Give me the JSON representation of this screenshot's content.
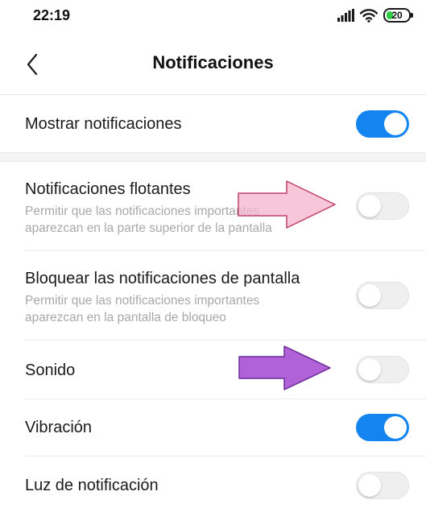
{
  "status_bar": {
    "time": "22:19",
    "battery_level": "20",
    "icons": [
      "signal-icon",
      "wifi-icon",
      "battery-icon"
    ]
  },
  "header": {
    "title": "Notificaciones",
    "back_icon": "chevron-left-icon"
  },
  "settings": [
    {
      "title": "Mostrar notificaciones",
      "subtitle": "",
      "enabled": true
    },
    {
      "title": "Notificaciones flotantes",
      "subtitle_line1": "Permitir que las notificaciones importantes",
      "subtitle_line2": "aparezcan en la parte superior de la pantalla",
      "enabled": false
    },
    {
      "title": "Bloquear las notificaciones de pantalla",
      "subtitle_line1": "Permitir que las notificaciones importantes",
      "subtitle_line2": "aparezcan en la pantalla de bloqueo",
      "enabled": false
    },
    {
      "title": "Sonido",
      "subtitle": "",
      "enabled": false
    },
    {
      "title": "Vibración",
      "subtitle": "",
      "enabled": true
    },
    {
      "title": "Luz de notificación",
      "subtitle": "",
      "enabled": false
    }
  ],
  "colors": {
    "toggle_on": "#1384f0",
    "toggle_off": "#efefef",
    "annotation_arrow_pink": "#f2a0c0",
    "annotation_arrow_purple": "#9b3fc8"
  }
}
